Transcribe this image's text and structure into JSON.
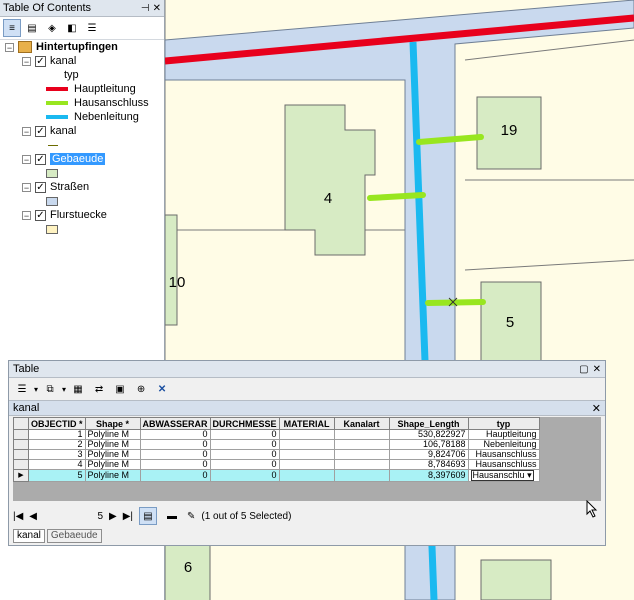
{
  "toc": {
    "title": "Table Of Contents",
    "pin_label": "p",
    "close_label": "×",
    "group": "Hintertupfingen",
    "layers": [
      {
        "name": "kanal",
        "field": "typ",
        "legend": [
          {
            "label": "Hauptleitung",
            "color": "#e8001c"
          },
          {
            "label": "Hausanschluss",
            "color": "#98e61f"
          },
          {
            "label": "Nebenleitung",
            "color": "#1ab9f0"
          }
        ]
      },
      {
        "name": "kanal"
      },
      {
        "name": "Gebaeude",
        "selected": true,
        "fill": "#d7ebc4"
      },
      {
        "name": "Straßen",
        "fill": "#c9d9ee"
      },
      {
        "name": "Flurstuecke",
        "fill": "#fff3c2"
      }
    ]
  },
  "map": {
    "labels": [
      "19",
      "4",
      "10",
      "5",
      "6"
    ]
  },
  "table": {
    "window_title": "Table",
    "layer_name": "kanal",
    "columns": [
      "OBJECTID *",
      "Shape *",
      "ABWASSERAR",
      "DURCHMESSE",
      "MATERIAL",
      "Kanalart",
      "Shape_Length",
      "typ"
    ],
    "rows": [
      {
        "OBJECTID": "1",
        "Shape": "Polyline M",
        "ABWASSERAR": "0",
        "DURCHMESSE": "0",
        "MATERIAL": "",
        "Kanalart": "",
        "Shape_Length": "530,822927",
        "typ": "Hauptleitung"
      },
      {
        "OBJECTID": "2",
        "Shape": "Polyline M",
        "ABWASSERAR": "0",
        "DURCHMESSE": "0",
        "MATERIAL": "",
        "Kanalart": "",
        "Shape_Length": "106,78188",
        "typ": "Nebenleitung"
      },
      {
        "OBJECTID": "3",
        "Shape": "Polyline M",
        "ABWASSERAR": "0",
        "DURCHMESSE": "0",
        "MATERIAL": "",
        "Kanalart": "",
        "Shape_Length": "9,824706",
        "typ": "Hausanschluss"
      },
      {
        "OBJECTID": "4",
        "Shape": "Polyline M",
        "ABWASSERAR": "0",
        "DURCHMESSE": "0",
        "MATERIAL": "",
        "Kanalart": "",
        "Shape_Length": "8,784693",
        "typ": "Hausanschluss"
      },
      {
        "OBJECTID": "5",
        "Shape": "Polyline M",
        "ABWASSERAR": "0",
        "DURCHMESSE": "0",
        "MATERIAL": "",
        "Kanalart": "",
        "Shape_Length": "8,397609",
        "typ": "Hausanschlu"
      }
    ],
    "nav_position": "5",
    "status": "(1 out of 5 Selected)",
    "tabs": [
      "kanal",
      "Gebaeude"
    ]
  }
}
